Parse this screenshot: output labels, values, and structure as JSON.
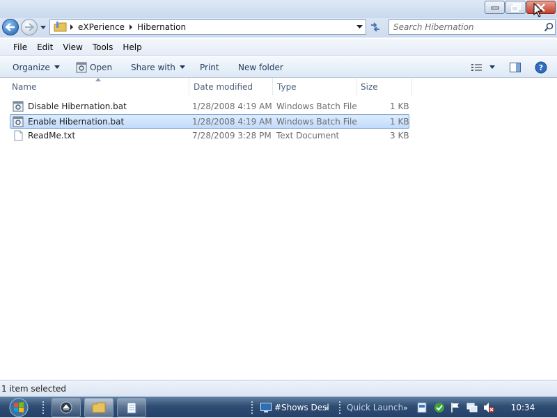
{
  "address": {
    "crumbs": [
      "eXPerience",
      "Hibernation"
    ]
  },
  "search": {
    "placeholder": "Search Hibernation"
  },
  "menu": [
    {
      "label": "File"
    },
    {
      "label": "Edit"
    },
    {
      "label": "View"
    },
    {
      "label": "Tools"
    },
    {
      "label": "Help"
    }
  ],
  "toolbar": {
    "organize": "Organize",
    "open": "Open",
    "share_with": "Share with",
    "print": "Print",
    "new_folder": "New folder"
  },
  "columns": {
    "name": "Name",
    "date_modified": "Date modified",
    "type": "Type",
    "size": "Size"
  },
  "files": [
    {
      "name": "Disable Hibernation.bat",
      "date": "1/28/2008 4:19 AM",
      "type": "Windows Batch File",
      "size": "1 KB",
      "icon": "batch-file-icon",
      "selected": false
    },
    {
      "name": "Enable Hibernation.bat",
      "date": "1/28/2008 4:19 AM",
      "type": "Windows Batch File",
      "size": "1 KB",
      "icon": "batch-file-icon",
      "selected": true
    },
    {
      "name": "ReadMe.txt",
      "date": "7/28/2009 3:28 PM",
      "type": "Text Document",
      "size": "3 KB",
      "icon": "text-file-icon",
      "selected": false
    }
  ],
  "status": {
    "text": "1 item selected"
  },
  "taskbar": {
    "shows_desktop": "#Shows Desl",
    "quick_launch": "Quick Launch",
    "clock": "10:34"
  }
}
